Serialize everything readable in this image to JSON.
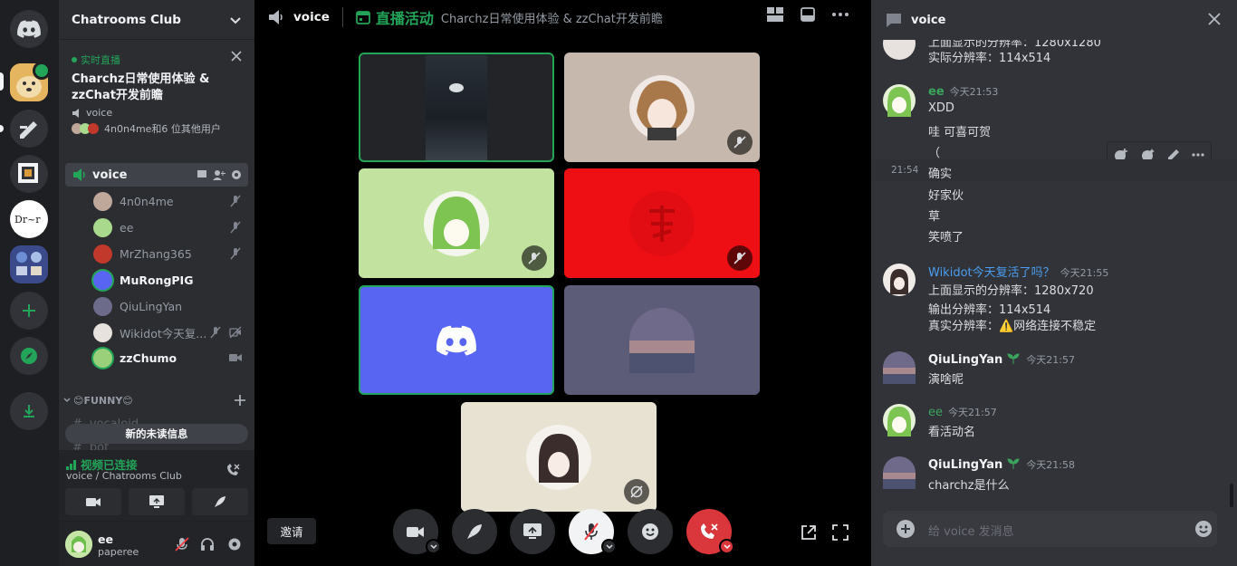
{
  "server": {
    "name": "Chatrooms Club"
  },
  "rail": {
    "icons": [
      "discord-home-icon",
      "doge-server-icon",
      "pen-server-icon",
      "square-server-icon",
      "logo-server-icon",
      "folder-server-icon",
      "add-server-icon",
      "explore-icon",
      "download-icon"
    ]
  },
  "live_event": {
    "badge": "实时直播",
    "title_line1": "Charchz日常使用体验 &",
    "title_line2": "zzChat开发前瞻",
    "channel": "voice",
    "participants": "4n0n4me和6 位其他用户"
  },
  "voice_channel": {
    "name": "voice"
  },
  "voice_users": [
    {
      "name": "4n0n4me",
      "color": "#bfa89a",
      "bold": false
    },
    {
      "name": "ee",
      "color": "#a8d98c",
      "bold": false
    },
    {
      "name": "MrZhang365",
      "color": "#c0392b",
      "bold": false
    },
    {
      "name": "MuRongPIG",
      "color": "#5865f2",
      "bold": true
    },
    {
      "name": "QiuLingYan",
      "color": "#6d6b8a",
      "bold": false
    },
    {
      "name": "Wikidot今天复...",
      "color": "#e8e2de",
      "bold": false
    },
    {
      "name": "zzChumo",
      "color": "#9ad07a",
      "bold": true
    }
  ],
  "category": {
    "name": "😊FUNNY😊"
  },
  "hidden_channels": [
    "vocaloid",
    "bot"
  ],
  "new_unread": "新的未读信息",
  "connection": {
    "status": "视频已连接",
    "location": "voice / Chatrooms Club"
  },
  "user": {
    "name": "ee",
    "status": "paperee"
  },
  "stage": {
    "channel": "voice",
    "event_name": "直播活动",
    "event_title": "Charchz日常使用体验 & zzChat开发前瞻",
    "invite": "邀请"
  },
  "chat": {
    "title": "voice",
    "input_placeholder": "给 voice 发消息",
    "messages": [
      {
        "lines": [
          "上面显示的分辨率：1280x1280",
          "实际分辨率：114x514"
        ]
      },
      {
        "author": "ee",
        "time": "今天21:53",
        "color": "#3ba55d",
        "lines": [
          "XDD",
          "哇 可喜可贺",
          "（"
        ]
      },
      {
        "hover_time": "21:54",
        "lines": [
          "确实",
          "好家伙",
          "草",
          "笑喷了"
        ]
      },
      {
        "author": "Wikidot今天复活了吗？",
        "time": "今天21:55",
        "color": "#4a9eef",
        "lines": [
          "上面显示的分辨率：1280x720",
          "输出分辨率：114x514",
          "真实分辨率：⚠️网络连接不稳定"
        ]
      },
      {
        "author": "QiuLingYan",
        "time": "今天21:57",
        "color": "#f2f3f5",
        "lines": [
          "演啥呢"
        ]
      },
      {
        "author": "ee",
        "time": "今天21:57",
        "color": "#3ba55d",
        "lines": [
          "看活动名"
        ]
      },
      {
        "author": "QiuLingYan",
        "time": "今天21:58",
        "color": "#f2f3f5",
        "lines": [
          "charchz是什么"
        ]
      }
    ]
  }
}
